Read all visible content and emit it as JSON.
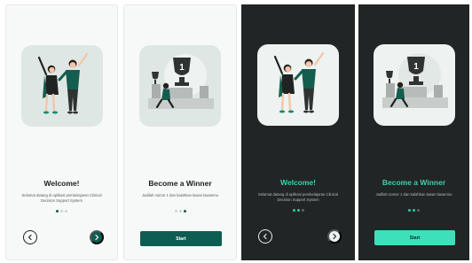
{
  "screens": [
    {
      "theme": "light",
      "title": "Welcome!",
      "description": "Selamat datang di aplikasi pembelajaran Clinical Decision Support System",
      "illustration": "couple-cheering-illustration",
      "page_index": 0,
      "prev_icon": "chevron-left-icon",
      "next_icon": "chevron-right-icon"
    },
    {
      "theme": "light",
      "title": "Become a Winner",
      "description": "Jadilah nomor 1 dan kalahkan lawan lawanmu",
      "illustration": "trophy-podium-illustration",
      "page_index": 2,
      "button_label": "Start"
    },
    {
      "theme": "dark",
      "title": "Welcome!",
      "description": "Selamat datang di aplikasi pembelajaran Clinical Decision Support System",
      "illustration": "couple-cheering-illustration",
      "page_index": 0,
      "prev_icon": "chevron-left-icon",
      "next_icon": "chevron-right-icon"
    },
    {
      "theme": "dark",
      "title": "Become a Winner",
      "description": "Jadilah nomor 1 dan kalahkan lawan lawanmu",
      "illustration": "trophy-podium-illustration",
      "page_index": 2,
      "button_label": "Start"
    }
  ],
  "pagination": {
    "total_pages": 3
  },
  "colors": {
    "primary": "#0d5d52",
    "accent_dark_mode": "#3ee0bb",
    "dark_background": "#222525",
    "light_background": "#f7f8f8"
  }
}
